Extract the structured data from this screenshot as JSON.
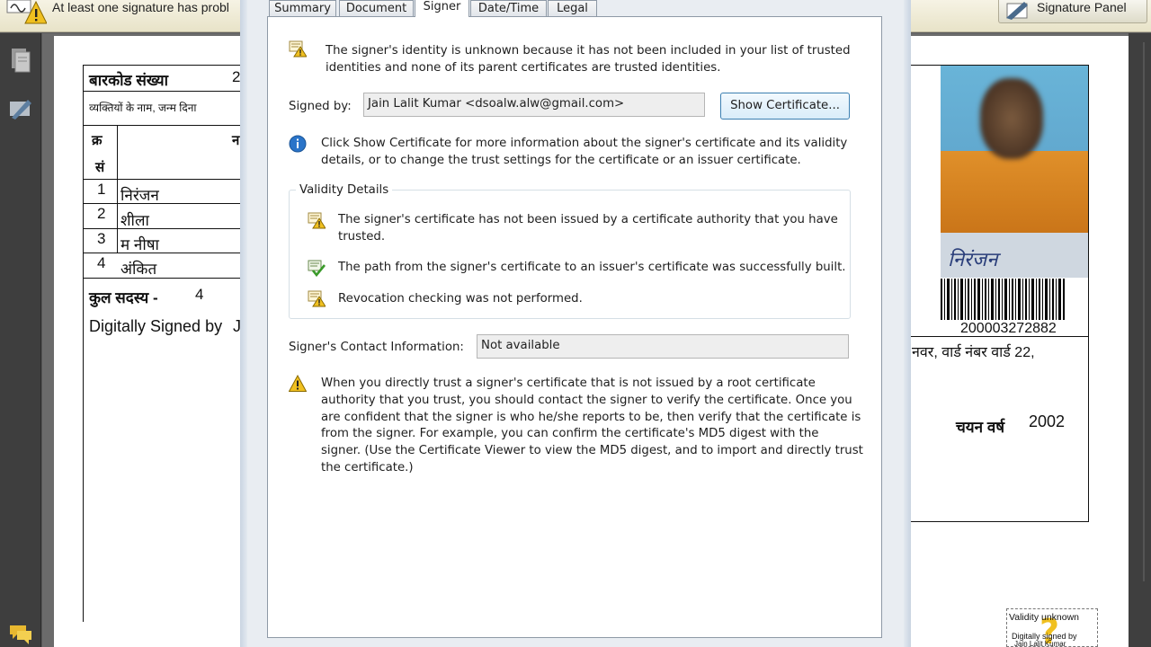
{
  "notification": {
    "message": "At least one signature has probl",
    "signature_panel_label": "Signature Panel"
  },
  "document": {
    "barcode_label": "बारकोड संख्या",
    "barcode_label_trail": "2",
    "persons_line": "व्यक्तियों के नाम, जन्म दिना",
    "col_sno_1": "क्र",
    "col_sno_2": "सं",
    "col_name": "न",
    "members": [
      {
        "no": "1",
        "name": "निरंजन"
      },
      {
        "no": "2",
        "name": "शीला"
      },
      {
        "no": "3",
        "name": "म नीषा"
      },
      {
        "no": "4",
        "name": "अंकित"
      }
    ],
    "total_label": "कुल सदस्य -",
    "total_value": "4",
    "digitally_signed": "Digitally Signed by",
    "digitally_signed_trail": "J",
    "barcode_number": "200003272882",
    "address_fragment": "नवर, वार्ड नंबर वार्ड 22,",
    "selection_year_label": "चयन वर्ष",
    "selection_year": "2002",
    "stamp_line1": "Validity unknown",
    "stamp_line2": "Digitally signed by",
    "stamp_line3": "Jain Lalit Kumar",
    "photo_caption": "निरंजन"
  },
  "dialog": {
    "tabs": [
      "Summary",
      "Document",
      "Signer",
      "Date/Time",
      "Legal"
    ],
    "active_tab": "Signer",
    "identity_warning_1": "The signer's identity is unknown because it has not been included in your list of trusted",
    "identity_warning_2": "identities and none of its parent certificates are trusted identities.",
    "signed_by_label": "Signed by:",
    "signed_by_value": "Jain Lalit Kumar <dsoalw.alw@gmail.com>",
    "show_certificate_label": "Show Certificate...",
    "info_1": "Click Show Certificate for more information about the signer's certificate and its validity",
    "info_2": "details, or to change the trust settings for the certificate or an issuer certificate.",
    "validity_title": "Validity Details",
    "validity_1a": "The signer's certificate has not been issued by a certificate authority that you have",
    "validity_1b": "trusted.",
    "validity_2": "The path from the signer's certificate to an issuer's certificate was successfully built.",
    "validity_3": "Revocation checking was not performed.",
    "contact_label": "Signer's Contact Information:",
    "contact_value": "Not available",
    "trust_lines": [
      "When you directly trust a signer's certificate that is not issued by a root certificate",
      "authority that you trust, you should contact the signer to verify the certificate. Once you",
      "are confident that the signer is who he/she reports to be, then verify that the certificate is",
      "from the signer. For example, you can confirm the certificate's MD5 digest with the",
      "signer. (Use the Certificate Viewer to view the MD5 digest, and to import and directly trust",
      "the certificate.)"
    ]
  },
  "icons": {
    "warning": "warning-icon",
    "info": "info-icon",
    "cert_warning": "certificate-warning-icon",
    "cert_ok": "certificate-ok-icon"
  },
  "colors": {
    "accent_blue": "#3c7fb1",
    "warning_yellow": "#f0c020",
    "info_blue": "#2a74c9"
  }
}
